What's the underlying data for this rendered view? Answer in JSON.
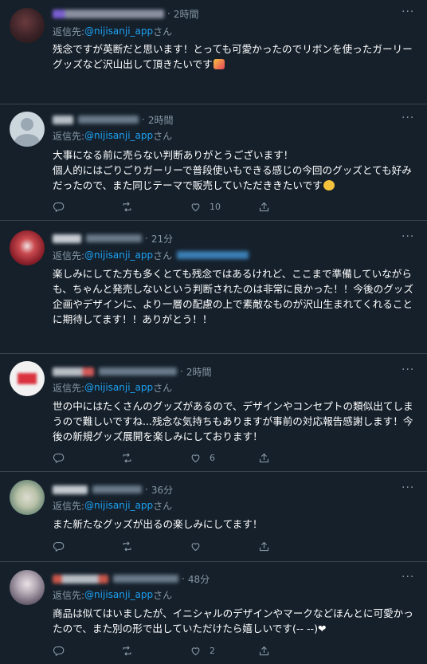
{
  "reply_prefix": "返信先: ",
  "reply_handle": "@nijisanji_app",
  "reply_suffix": "さん",
  "tweets": [
    {
      "time": "2時間",
      "body": "残念ですが英断だと思います！とっても可愛かったのでリボンを使ったガーリーグッズなど沢山出して頂きたいです",
      "reply_count": "",
      "retweet_count": "",
      "like_count": ""
    },
    {
      "time": "2時間",
      "body": "大事になる前に売らない判断ありがとうございます！\n個人的にはごりごりガーリーで普段使いもできる感じの今回のグッズとても好みだったので、また同じテーマで販売していただききたいです",
      "reply_count": "",
      "retweet_count": "",
      "like_count": "10"
    },
    {
      "time": "21分",
      "body": "楽しみにしてた方も多くとても残念ではあるけれど、ここまで準備していながらも、ちゃんと発売しないという判断されたのは非常に良かった！！今後のグッズ企画やデザインに、より一層の配慮の上で素敵なものが沢山生まれてくれることに期待してます！！ありがとう！！",
      "reply_count": "",
      "retweet_count": "",
      "like_count": ""
    },
    {
      "time": "2時間",
      "body": "世の中にはたくさんのグッズがあるので、デザインやコンセプトの類似出てしまうので難しいですね...残念な気持ちもありますが事前の対応報告感謝します！今後の新規グッズ展開を楽しみにしております！",
      "reply_count": "",
      "retweet_count": "",
      "like_count": "6"
    },
    {
      "time": "36分",
      "body": "また新たなグッズが出るの楽しみにしてます！",
      "reply_count": "",
      "retweet_count": "",
      "like_count": ""
    },
    {
      "time": "48分",
      "body": "商品は似てはいましたが、イニシャルのデザインやマークなどほんとに可愛かったので、また別の形で出していただけたら嬉しいです(-- --)❤",
      "reply_count": "",
      "retweet_count": "",
      "like_count": "2"
    }
  ],
  "colors": {
    "background": "#15202b",
    "divider": "#38444d",
    "secondary_text": "#8899a6",
    "link": "#1da1f2"
  },
  "icons": [
    "reply-icon",
    "retweet-icon",
    "like-icon",
    "share-icon",
    "more-icon"
  ]
}
